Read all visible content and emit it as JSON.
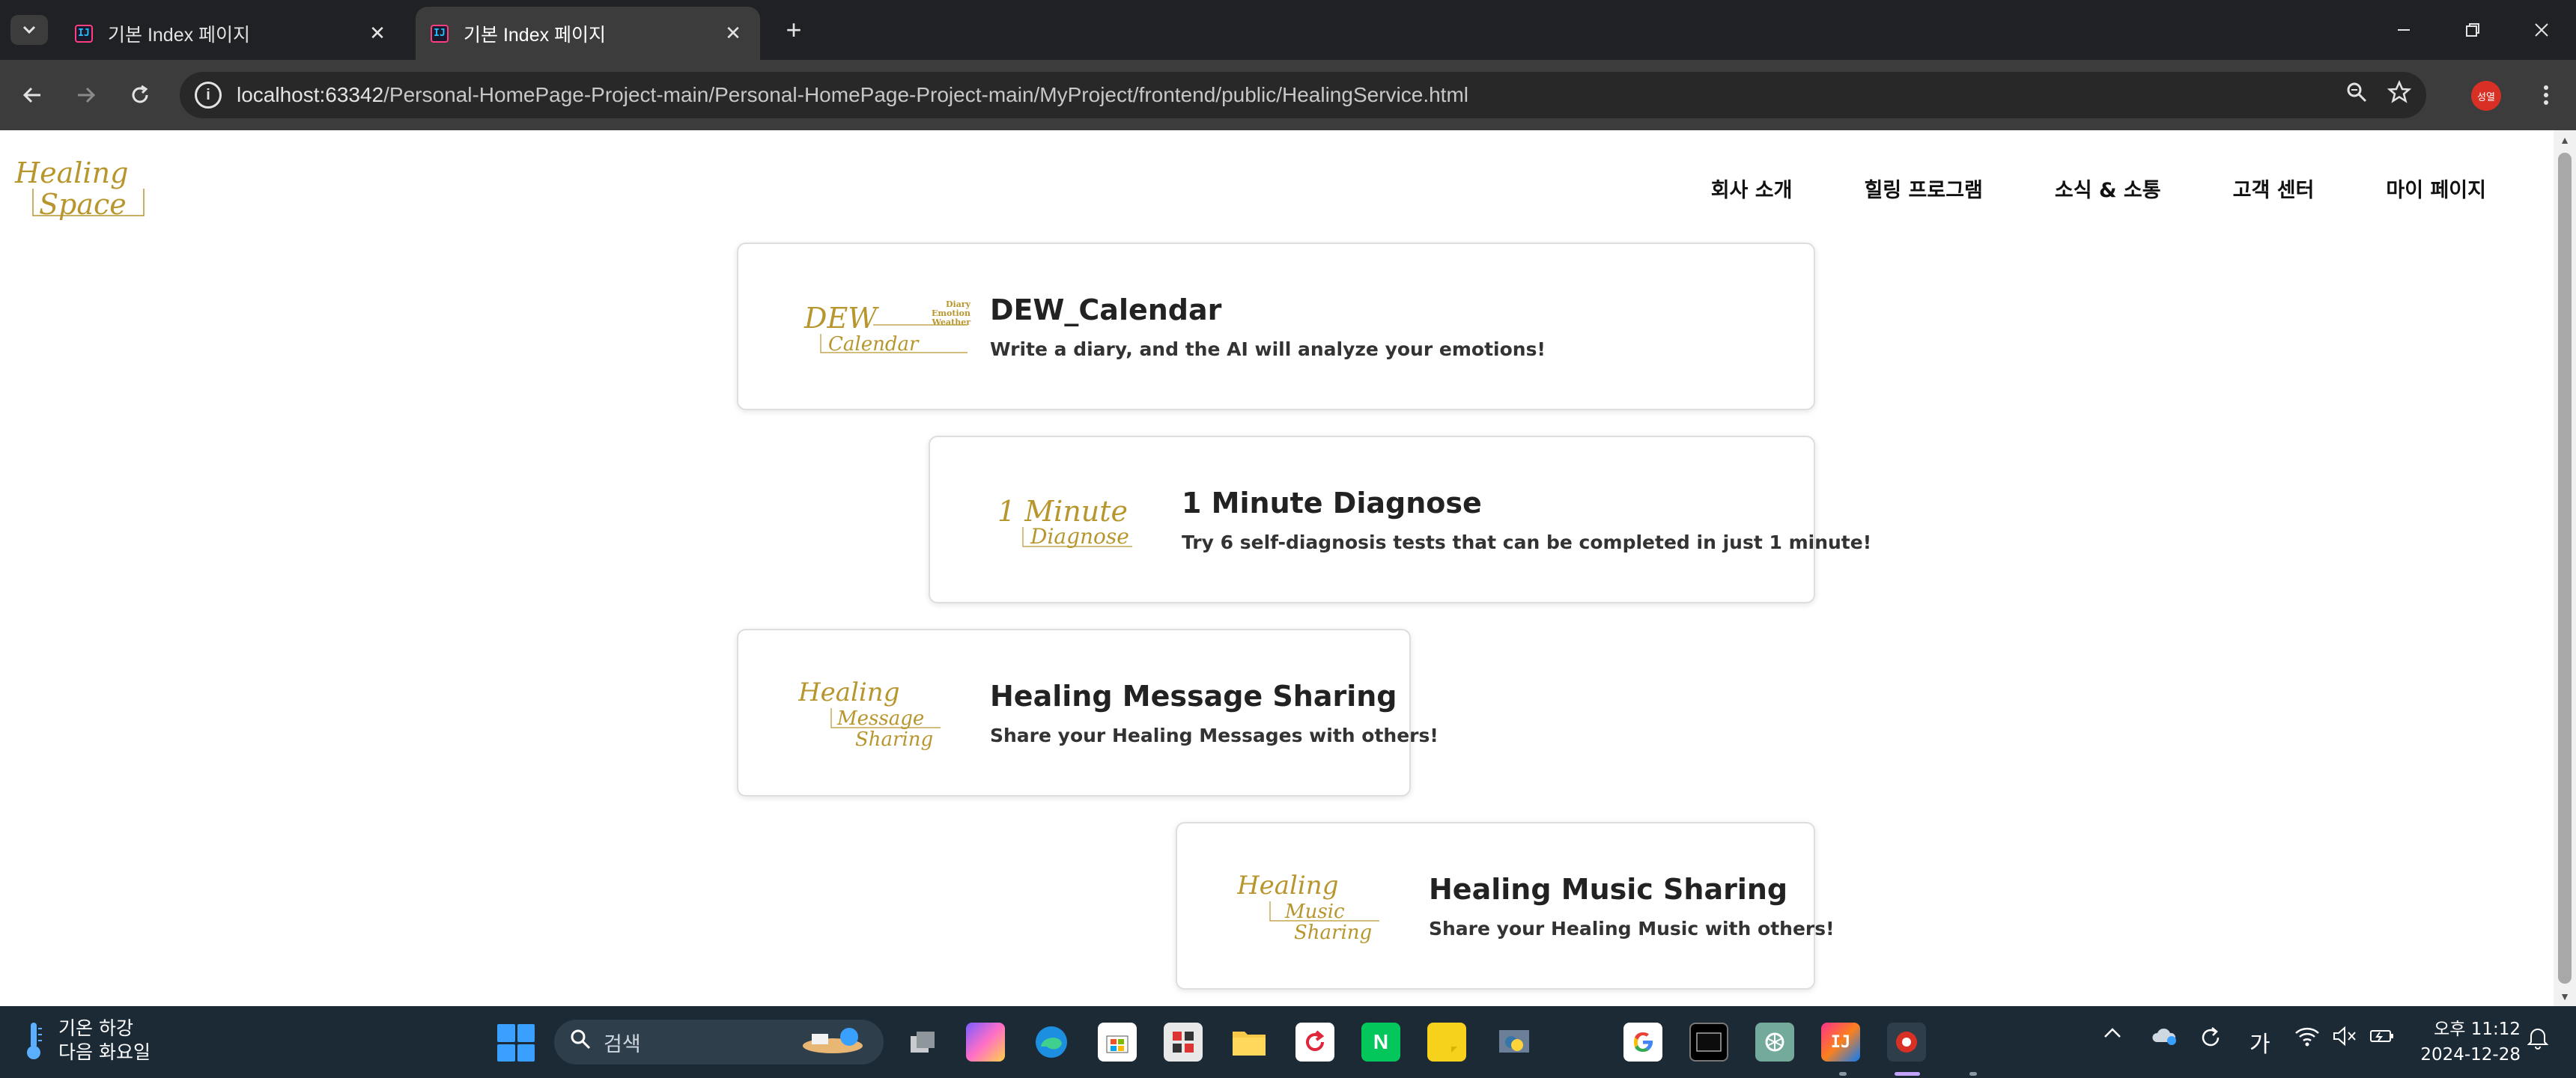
{
  "browser": {
    "tabs": [
      {
        "title": "기본 Index 페이지",
        "active": false
      },
      {
        "title": "기본 Index 페이지",
        "active": true
      }
    ],
    "url_host": "localhost:63342",
    "url_path": "/Personal-HomePage-Project-main/Personal-HomePage-Project-main/MyProject/frontend/public/HealingService.html",
    "profile_initial": "성열"
  },
  "site": {
    "logo_text_1": "Healing",
    "logo_text_2": "Space",
    "nav": [
      "회사 소개",
      "힐링 프로그램",
      "소식 & 소통",
      "고객 센터",
      "마이 페이지"
    ]
  },
  "cards": [
    {
      "title": "DEW_Calendar",
      "description": "Write a diary, and the AI will analyze your emotions!",
      "logo_main": "DEW",
      "logo_sub": "Calendar",
      "logo_side": [
        "Diary",
        "Emotion",
        "Weather"
      ]
    },
    {
      "title": "1 Minute Diagnose",
      "description": "Try 6 self-diagnosis tests that can be completed in just 1 minute!",
      "logo_main": "1 Minute",
      "logo_sub": "Diagnose"
    },
    {
      "title": "Healing Message Sharing",
      "description": "Share your Healing Messages with others!",
      "logo_main": "Healing",
      "logo_mid": "Message",
      "logo_sub": "Sharing"
    },
    {
      "title": "Healing Music Sharing",
      "description": "Share your Healing Music with others!",
      "logo_main": "Healing",
      "logo_mid": "Music",
      "logo_sub": "Sharing"
    }
  ],
  "taskbar": {
    "weather_line1": "기온 하강",
    "weather_line2": "다음 화요일",
    "search_placeholder": "검색",
    "ime_label": "가",
    "time": "오후 11:12",
    "date": "2024-12-28"
  },
  "colors": {
    "brand_gold": "#b8962e",
    "taskbar_bg": "#1c2a36",
    "browser_dark": "#202124"
  }
}
